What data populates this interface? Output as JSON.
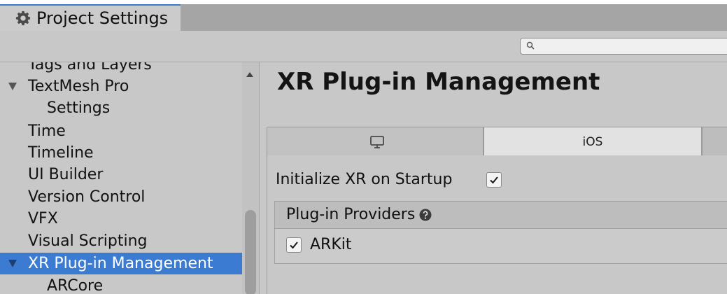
{
  "window": {
    "title": "Project Settings"
  },
  "search": {
    "value": "",
    "placeholder": ""
  },
  "sidebar": {
    "items": [
      {
        "label": "Tags and Layers",
        "expandable": false,
        "selected": false,
        "partially_visible": true
      },
      {
        "label": "TextMesh Pro",
        "expandable": true,
        "selected": false
      },
      {
        "label": "Settings",
        "expandable": false,
        "selected": false,
        "child": true
      },
      {
        "label": "Time",
        "expandable": false,
        "selected": false
      },
      {
        "label": "Timeline",
        "expandable": false,
        "selected": false
      },
      {
        "label": "UI Builder",
        "expandable": false,
        "selected": false
      },
      {
        "label": "Version Control",
        "expandable": false,
        "selected": false
      },
      {
        "label": "VFX",
        "expandable": false,
        "selected": false
      },
      {
        "label": "Visual Scripting",
        "expandable": false,
        "selected": false
      },
      {
        "label": "XR Plug-in Management",
        "expandable": true,
        "selected": true
      },
      {
        "label": "ARCore",
        "expandable": false,
        "selected": false,
        "child": true
      }
    ]
  },
  "main": {
    "title": "XR Plug-in Management",
    "platform_tabs": [
      {
        "icon": "monitor-icon",
        "label": "",
        "selected": false
      },
      {
        "label": "iOS",
        "selected": true
      }
    ],
    "initialize": {
      "label": "Initialize XR on Startup",
      "checked": true
    },
    "providers": {
      "header": "Plug-in Providers",
      "help_icon": "help-icon",
      "items": [
        {
          "label": "ARKit",
          "checked": true
        }
      ]
    }
  },
  "colors": {
    "selection": "#3b7bd2",
    "panel": "#c8c8c8",
    "tab_bar": "#a5a5a5",
    "active_tab": "#e2e2e2"
  },
  "icons": [
    "gear-icon",
    "search-icon",
    "monitor-icon",
    "checkmark-icon",
    "help-icon",
    "expand-triangle-icon",
    "scroll-up-arrow-icon"
  ]
}
